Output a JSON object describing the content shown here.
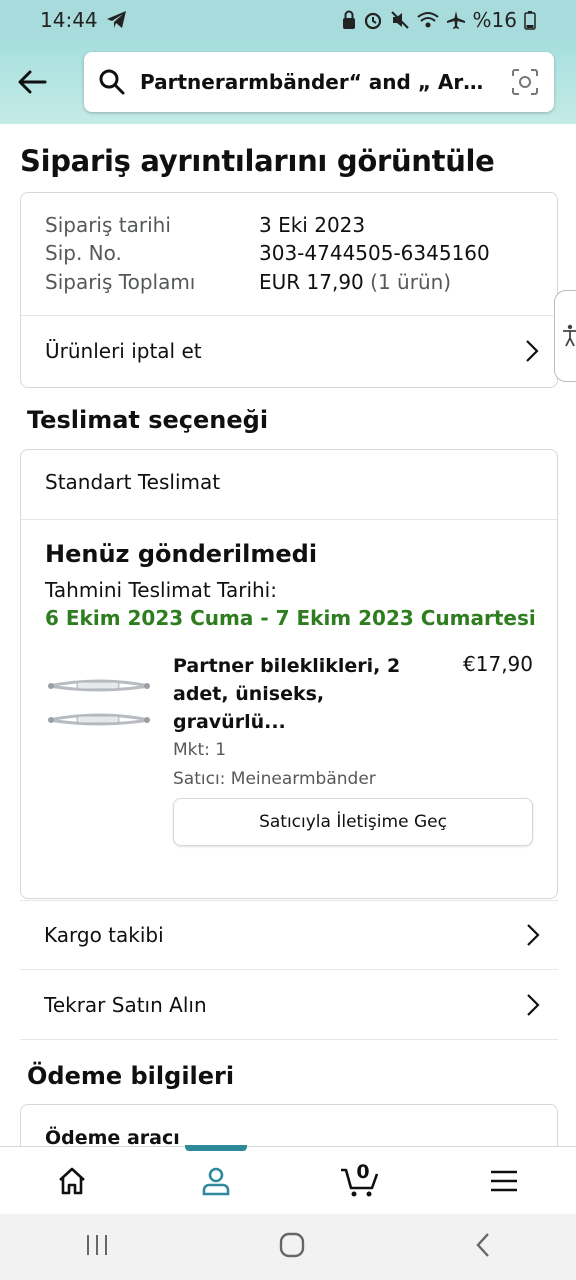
{
  "status_bar": {
    "time": "14:44",
    "battery": "%16"
  },
  "search": {
    "query": "Partnerarmbänder“ and „ Armba..."
  },
  "page": {
    "title": "Sipariş ayrıntılarını görüntüle"
  },
  "summary": {
    "order_date_label": "Sipariş tarihi",
    "order_date_value": "3 Eki 2023",
    "order_no_label": "Sip. No.",
    "order_no_value": "303-4744505-6345160",
    "total_label": "Sipariş Toplamı",
    "total_value": "EUR 17,90",
    "total_items": "(1 ürün)",
    "cancel_label": "Ürünleri iptal et"
  },
  "delivery": {
    "section_title": "Teslimat seçeneği",
    "option": "Standart Teslimat",
    "status": "Henüz gönderilmedi",
    "eta_label": "Tahmini Teslimat Tarihi:",
    "eta_value": "6 Ekim 2023 Cuma - 7 Ekim 2023 Cumartesi"
  },
  "product": {
    "name": "Partner bileklikleri, 2 adet, üniseks, gravürlü...",
    "price": "€17,90",
    "qty": "Mkt: 1",
    "seller": "Satıcı: Meinearmbänder",
    "contact_label": "Satıcıyla İletişime Geç"
  },
  "actions": {
    "track_label": "Kargo takibi",
    "buy_again_label": "Tekrar Satın Alın"
  },
  "payment": {
    "section_title": "Ödeme bilgileri",
    "method_label": "Ödeme aracı"
  },
  "nav": {
    "cart_count": "0"
  },
  "colors": {
    "header": "#a8dcdc",
    "accent": "#2e8a9b",
    "eta_green": "#2e7d1f"
  }
}
